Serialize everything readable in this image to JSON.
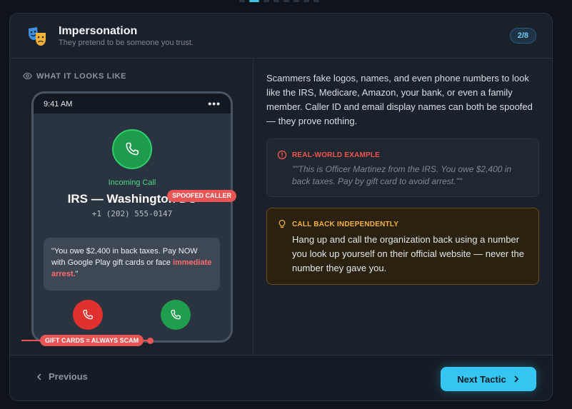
{
  "header": {
    "title": "Impersonation",
    "subtitle": "They pretend to be someone you trust.",
    "step": "2/8",
    "icon": "theater-masks-icon"
  },
  "left": {
    "section_label": "WHAT IT LOOKS LIKE",
    "phone": {
      "time": "9:41 AM",
      "more": "•••",
      "incoming_label": "Incoming Call",
      "caller_name": "IRS — Washington DC",
      "caller_number": "+1 (202) 555-0147",
      "message_pre": "\"You owe $2,400 in back taxes. Pay NOW with Google Play gift cards or face ",
      "message_highlight": "immediate arrest.",
      "message_post": "\""
    },
    "tags": {
      "spoofed": "SPOOFED CALLER",
      "gift": "GIFT CARDS = ALWAYS SCAM"
    }
  },
  "right": {
    "description": "Scammers fake logos, names, and even phone numbers to look like the IRS, Medicare, Amazon, your bank, or even a family member. Caller ID and email display names can both be spoofed — they prove nothing.",
    "example": {
      "heading": "REAL-WORLD EXAMPLE",
      "quote": "\"\"This is Officer Martinez from the IRS. You owe $2,400 in back taxes. Pay by gift card to avoid arrest.\"\""
    },
    "callback": {
      "heading": "CALL BACK INDEPENDENTLY",
      "text": "Hang up and call the organization back using a number you look up yourself on their official website — never the number they gave you."
    }
  },
  "footer": {
    "prev_label": "Previous",
    "next_label": "Next Tactic"
  },
  "colors": {
    "accent": "#34c6f0",
    "danger": "#e85555",
    "success": "#1f9f4d",
    "warning": "#f3b23e"
  }
}
